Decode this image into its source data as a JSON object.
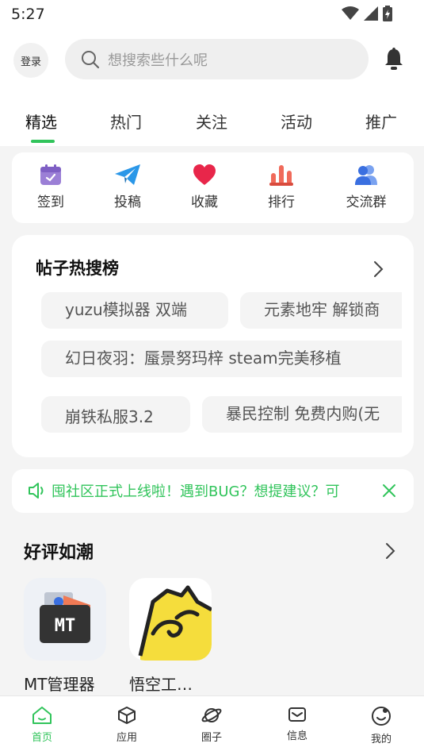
{
  "status_bar": {
    "time": "5:27"
  },
  "header": {
    "login_label": "登录",
    "search_placeholder": "想搜索些什么呢"
  },
  "tabs": [
    {
      "label": "精选",
      "active": true
    },
    {
      "label": "热门"
    },
    {
      "label": "关注"
    },
    {
      "label": "活动"
    },
    {
      "label": "推广"
    }
  ],
  "quick_actions": [
    {
      "label": "签到",
      "icon": "calendar-icon",
      "color": "#9b7fd6"
    },
    {
      "label": "投稿",
      "icon": "paper-plane-icon",
      "color": "#2a97e8"
    },
    {
      "label": "收藏",
      "icon": "heart-icon",
      "color": "#e8264a"
    },
    {
      "label": "排行",
      "icon": "bar-chart-icon",
      "color": "#f06a5a"
    },
    {
      "label": "交流群",
      "icon": "users-icon",
      "color": "#3a6fe0"
    }
  ],
  "hot_search": {
    "title": "帖子热搜榜",
    "chips": [
      "yuzu模拟器 双端",
      "元素地牢 解锁商",
      "幻日夜羽：蜃景努玛梓 steam完美移植",
      "崩铁私服3.2",
      "暴民控制 免费内购(无"
    ]
  },
  "notice": {
    "text": "囤社区正式上线啦！遇到BUG？想提建议？可"
  },
  "section": {
    "title": "好评如潮",
    "apps": [
      {
        "name": "MT管理器"
      },
      {
        "name": "悟空工…"
      }
    ]
  },
  "bottom_nav": [
    {
      "label": "首页",
      "icon": "home-icon",
      "active": true
    },
    {
      "label": "应用",
      "icon": "cube-icon"
    },
    {
      "label": "圈子",
      "icon": "planet-icon"
    },
    {
      "label": "信息",
      "icon": "mail-icon"
    },
    {
      "label": "我的",
      "icon": "smile-icon"
    }
  ],
  "colors": {
    "accent": "#31c45b"
  }
}
